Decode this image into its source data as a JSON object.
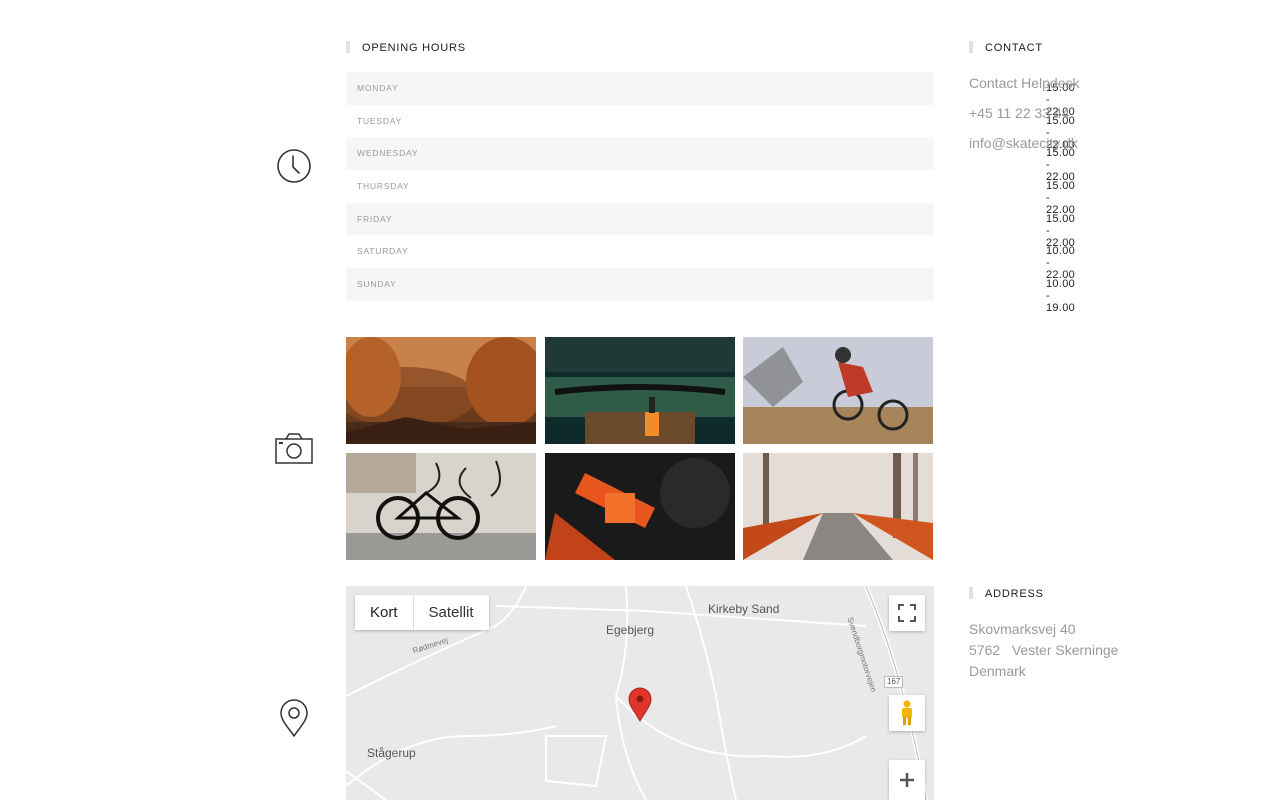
{
  "hours": {
    "title": "OPENING HOURS",
    "rows": [
      {
        "day": "MONDAY",
        "time": "15.00 - 22.00"
      },
      {
        "day": "TUESDAY",
        "time": "15.00 - 22.00"
      },
      {
        "day": "WEDNESDAY",
        "time": "15.00 - 22.00"
      },
      {
        "day": "THURSDAY",
        "time": "15.00 - 22.00"
      },
      {
        "day": "FRIDAY",
        "time": "15.00 - 22.00"
      },
      {
        "day": "SATURDAY",
        "time": "10.00 - 22.00"
      },
      {
        "day": "SUNDAY",
        "time": "10.00 - 19.00"
      }
    ]
  },
  "contact": {
    "title": "CONTACT",
    "helpdesk": "Contact Helpdesk",
    "phone": "+45 11 22 33 44",
    "email": "info@skatecity.dk"
  },
  "address": {
    "title": "ADDRESS",
    "street": "Skovmarksvej 40",
    "city": "5762   Vester Skerninge",
    "country": "Denmark"
  },
  "map": {
    "type_map": "Kort",
    "type_satellite": "Satellit",
    "places": {
      "kirkeby": "Kirkeby Sand",
      "egebjerg": "Egebjerg",
      "stagerup": "Stågerup",
      "rodmevej": "Rødmevej",
      "road_shield": "167",
      "road_name": "Svendborgmotorvejen"
    }
  },
  "icons": {
    "clock": "clock-icon",
    "camera": "camera-icon",
    "pin": "map-pin-icon"
  }
}
